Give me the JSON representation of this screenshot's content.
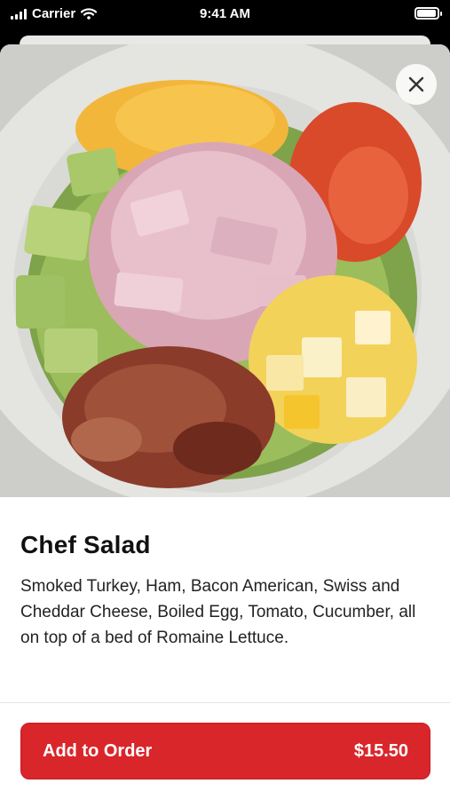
{
  "status_bar": {
    "carrier": "Carrier",
    "time": "9:41 AM"
  },
  "item": {
    "name": "Chef Salad",
    "description": "Smoked Turkey, Ham, Bacon American, Swiss and Cheddar Cheese, Boiled Egg, Tomato, Cucumber, all on top of a bed of Romaine Lettuce.",
    "image_icon": "salad-photo"
  },
  "actions": {
    "close_icon": "close-icon",
    "add_label": "Add to Order",
    "price": "$15.50"
  },
  "colors": {
    "accent": "#d9262b",
    "background": "#ffffff",
    "title_text": "#111111"
  }
}
